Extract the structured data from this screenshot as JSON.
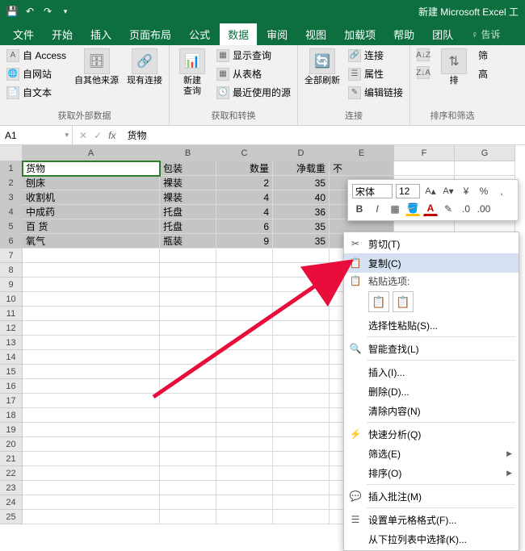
{
  "title": "新建 Microsoft Excel 工",
  "tabs": [
    "文件",
    "开始",
    "插入",
    "页面布局",
    "公式",
    "数据",
    "审阅",
    "视图",
    "加载项",
    "帮助",
    "团队"
  ],
  "tell": "告诉",
  "active_tab": 5,
  "ribbon": {
    "g1": {
      "label": "获取外部数据",
      "access": "自 Access",
      "web": "自网站",
      "text": "自文本",
      "other": "自其他来源",
      "conn": "现有连接"
    },
    "g2": {
      "label": "获取和转换",
      "query": "新建\n查询",
      "show": "显示查询",
      "table": "从表格",
      "recent": "最近使用的源"
    },
    "g3": {
      "label": "连接",
      "refresh": "全部刷新",
      "conn": "连接",
      "prop": "属性",
      "edit": "编辑链接"
    },
    "g4": {
      "label": "排序和筛选",
      "az": "A↓Z",
      "za": "Z↓A",
      "sort": "排",
      "filter": "筛",
      "adv": "高"
    }
  },
  "namebox": "A1",
  "formula": "货物",
  "cols": [
    "A",
    "B",
    "C",
    "D",
    "E",
    "F",
    "G"
  ],
  "data_rows": [
    {
      "n": 1,
      "A": "货物",
      "B": "包装",
      "C": "数量",
      "D": "净载重",
      "E": "不"
    },
    {
      "n": 2,
      "A": "刨床",
      "B": "裸装",
      "C": "2",
      "D": "35",
      "E": ""
    },
    {
      "n": 3,
      "A": "收割机",
      "B": "裸装",
      "C": "4",
      "D": "40",
      "E": ""
    },
    {
      "n": 4,
      "A": "中成药",
      "B": "托盘",
      "C": "4",
      "D": "36",
      "E": ""
    },
    {
      "n": 5,
      "A": "百 货",
      "B": "托盘",
      "C": "6",
      "D": "35",
      "E": ""
    },
    {
      "n": 6,
      "A": "氧气",
      "B": "瓶装",
      "C": "9",
      "D": "35",
      "E": ""
    }
  ],
  "mini": {
    "font": "宋体",
    "size": "12"
  },
  "ctx": {
    "cut": "剪切(T)",
    "copy": "复制(C)",
    "paste_label": "粘贴选项:",
    "paste_special": "选择性粘贴(S)...",
    "smart": "智能查找(L)",
    "insert": "插入(I)...",
    "delete": "删除(D)...",
    "clear": "清除内容(N)",
    "quick": "快速分析(Q)",
    "filter": "筛选(E)",
    "sort": "排序(O)",
    "comment": "插入批注(M)",
    "format": "设置单元格格式(F)...",
    "dropdown": "从下拉列表中选择(K)..."
  },
  "chart_data": {
    "type": "table",
    "columns": [
      "货物",
      "包装",
      "数量",
      "净载重"
    ],
    "rows": [
      [
        "刨床",
        "裸装",
        2,
        35
      ],
      [
        "收割机",
        "裸装",
        4,
        40
      ],
      [
        "中成药",
        "托盘",
        4,
        36
      ],
      [
        "百 货",
        "托盘",
        6,
        35
      ],
      [
        "氧气",
        "瓶装",
        9,
        35
      ]
    ]
  }
}
